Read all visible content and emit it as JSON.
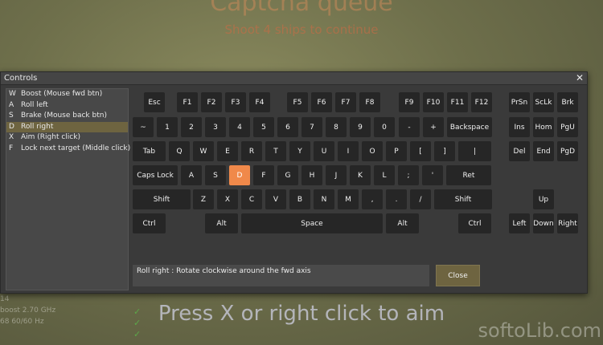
{
  "background": {
    "title": "Captcha queue",
    "subtitle": "Shoot 4 ships to continue",
    "hint": "Press X or right click to aim",
    "stats": [
      "14",
      "boost 2.70 GHz",
      "68 60/60 Hz"
    ],
    "watermark": "softoLib.com"
  },
  "dialog": {
    "title": "Controls",
    "close_label": "Close",
    "description": "Roll right :   Rotate clockwise around the fwd axis"
  },
  "bindings": [
    {
      "key": "W",
      "action": "Boost (Mouse fwd btn)"
    },
    {
      "key": "A",
      "action": "Roll left"
    },
    {
      "key": "S",
      "action": "Brake (Mouse back btn)"
    },
    {
      "key": "D",
      "action": "Roll right"
    },
    {
      "key": "X",
      "action": "Aim (Right click)"
    },
    {
      "key": "F",
      "action": "Lock next target (Middle click)"
    }
  ],
  "selected_binding": 3,
  "accent_color": "#f0894a",
  "keyboard": [
    {
      "label": "Esc"
    },
    {
      "label": "F1"
    },
    {
      "label": "F2"
    },
    {
      "label": "F3"
    },
    {
      "label": "F4"
    },
    {
      "label": "F5"
    },
    {
      "label": "F6"
    },
    {
      "label": "F7"
    },
    {
      "label": "F8"
    },
    {
      "label": "F9"
    },
    {
      "label": "F10"
    },
    {
      "label": "F11"
    },
    {
      "label": "F12"
    },
    {
      "label": "PrSn"
    },
    {
      "label": "ScLk"
    },
    {
      "label": "Brk"
    },
    {
      "label": "~"
    },
    {
      "label": "1"
    },
    {
      "label": "2"
    },
    {
      "label": "3"
    },
    {
      "label": "4"
    },
    {
      "label": "5"
    },
    {
      "label": "6"
    },
    {
      "label": "7"
    },
    {
      "label": "8"
    },
    {
      "label": "9"
    },
    {
      "label": "0"
    },
    {
      "label": "-"
    },
    {
      "label": "+"
    },
    {
      "label": "Backspace"
    },
    {
      "label": "Ins"
    },
    {
      "label": "Hom"
    },
    {
      "label": "PgU"
    },
    {
      "label": "Tab"
    },
    {
      "label": "Q"
    },
    {
      "label": "W"
    },
    {
      "label": "E"
    },
    {
      "label": "R"
    },
    {
      "label": "T"
    },
    {
      "label": "Y"
    },
    {
      "label": "U"
    },
    {
      "label": "I"
    },
    {
      "label": "O"
    },
    {
      "label": "P"
    },
    {
      "label": "["
    },
    {
      "label": "]"
    },
    {
      "label": "|"
    },
    {
      "label": "Del"
    },
    {
      "label": "End"
    },
    {
      "label": "PgD"
    },
    {
      "label": "Caps Lock"
    },
    {
      "label": "A"
    },
    {
      "label": "S"
    },
    {
      "label": "D",
      "active": true
    },
    {
      "label": "F"
    },
    {
      "label": "G"
    },
    {
      "label": "H"
    },
    {
      "label": "J"
    },
    {
      "label": "K"
    },
    {
      "label": "L"
    },
    {
      "label": ";"
    },
    {
      "label": "'"
    },
    {
      "label": "Ret"
    },
    {
      "label": "Shift"
    },
    {
      "label": "Z"
    },
    {
      "label": "X"
    },
    {
      "label": "C"
    },
    {
      "label": "V"
    },
    {
      "label": "B"
    },
    {
      "label": "N"
    },
    {
      "label": "M"
    },
    {
      "label": ","
    },
    {
      "label": "."
    },
    {
      "label": "/"
    },
    {
      "label": "Shift"
    },
    {
      "label": "Up"
    },
    {
      "label": "Ctrl"
    },
    {
      "label": "Alt"
    },
    {
      "label": "Space"
    },
    {
      "label": "Alt"
    },
    {
      "label": "Ctrl"
    },
    {
      "label": "Left"
    },
    {
      "label": "Down"
    },
    {
      "label": "Right"
    }
  ]
}
